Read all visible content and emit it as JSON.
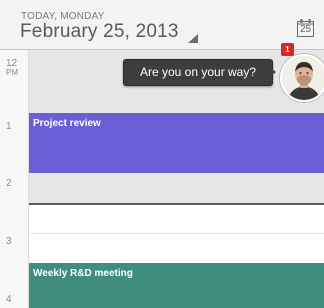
{
  "header": {
    "day_label": "TODAY, MONDAY",
    "date_title": "February 25, 2013",
    "today_button_day": "25"
  },
  "hours": [
    {
      "label": "12",
      "sub": "PM"
    },
    {
      "label": "1",
      "sub": ""
    },
    {
      "label": "2",
      "sub": ""
    },
    {
      "label": "3",
      "sub": ""
    },
    {
      "label": "4",
      "sub": ""
    }
  ],
  "events": [
    {
      "title": "Project review",
      "color": "#6a5fd6"
    },
    {
      "title": "Weekly R&D meeting",
      "color": "#3f8e7d"
    }
  ],
  "notification": {
    "message": "Are you on your way?",
    "badge_count": "1",
    "badge_color": "#d9281f"
  }
}
